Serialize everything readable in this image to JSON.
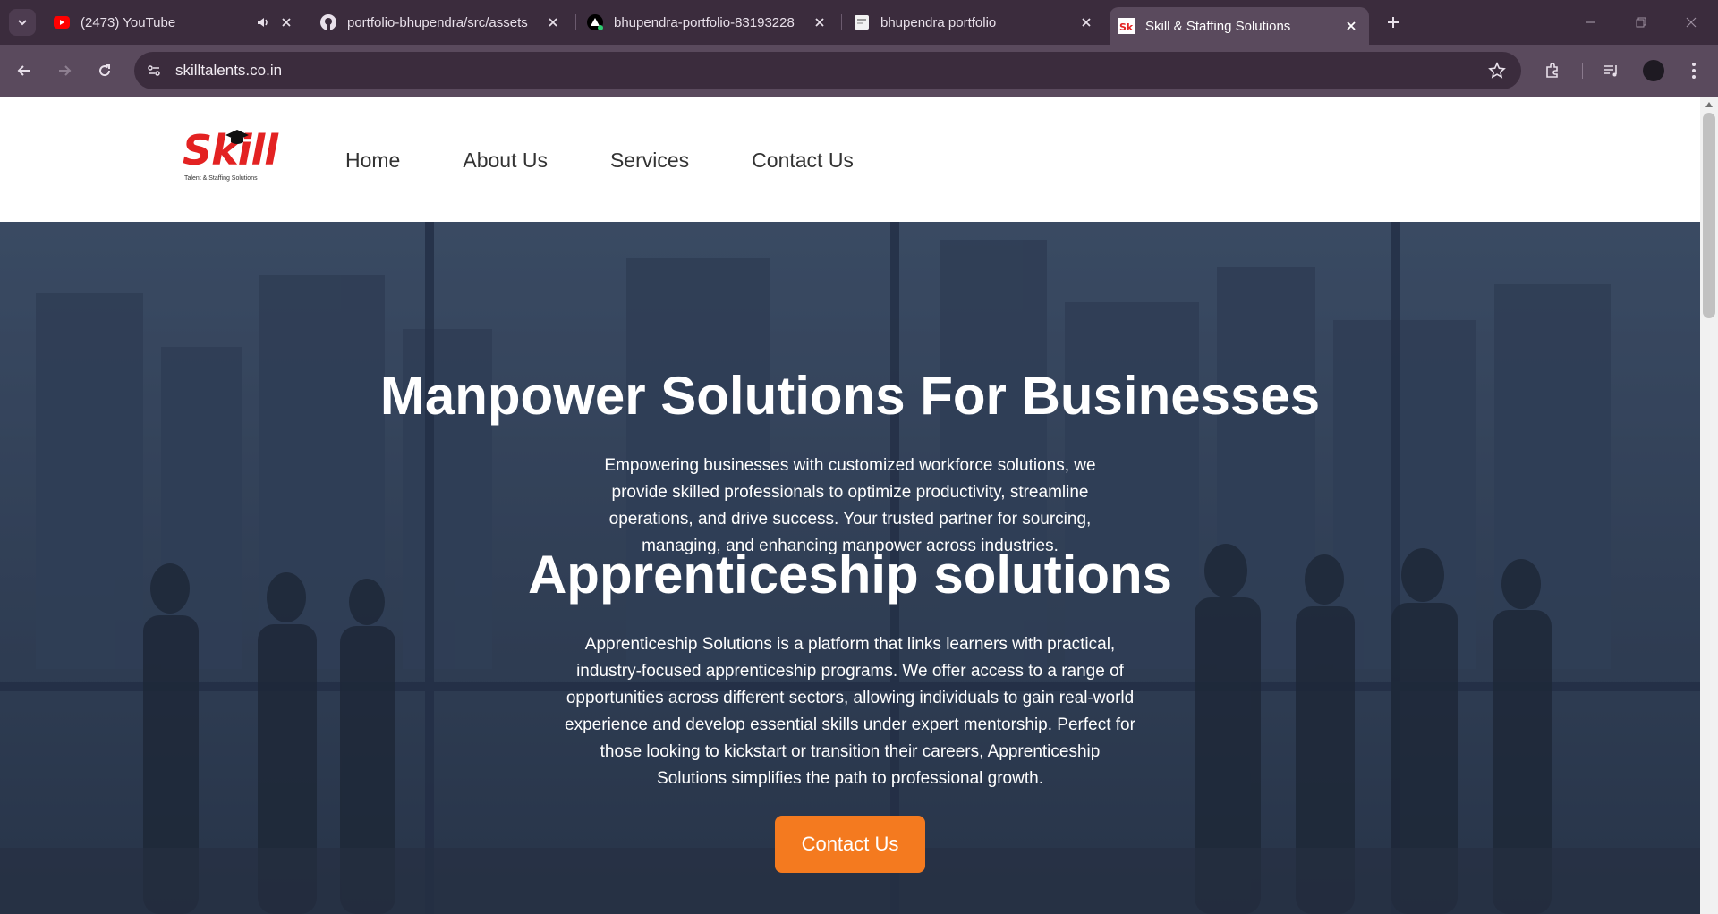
{
  "browser": {
    "tabs": [
      {
        "title": "(2473) YouTube",
        "favicon": "youtube-icon",
        "audio": true
      },
      {
        "title": "portfolio-bhupendra/src/assets",
        "favicon": "github-icon"
      },
      {
        "title": "bhupendra-portfolio-83193228",
        "favicon": "vercel-icon"
      },
      {
        "title": "bhupendra portfolio",
        "favicon": "page-icon"
      },
      {
        "title": "Skill & Staffing Solutions",
        "favicon": "skill-favicon",
        "active": true
      }
    ],
    "url": "skilltalents.co.in",
    "colors": {
      "frame": "#3b2c3d",
      "toolbar": "#5a4a5d"
    }
  },
  "site": {
    "logo": {
      "text": "Skill",
      "tagline": "Talent & Staffing Solutions"
    },
    "nav": [
      "Home",
      "About Us",
      "Services",
      "Contact Us"
    ],
    "hero": {
      "heading_1": "Manpower Solutions For Businesses",
      "text_1": "Empowering businesses with customized workforce solutions, we provide skilled professionals to optimize productivity, streamline operations, and drive success. Your trusted partner for sourcing, managing, and enhancing manpower across industries.",
      "heading_2": "Apprenticeship solutions",
      "text_2": "Apprenticeship Solutions is a platform that links learners with practical, industry-focused apprenticeship programs. We offer access to a range of opportunities across different sectors, allowing individuals to gain real-world experience and develop essential skills under expert mentorship. Perfect for those looking to kickstart or transition their careers, Apprenticeship Solutions simplifies the path to professional growth.",
      "cta_label": "Contact Us"
    },
    "colors": {
      "accent": "#f47a1f",
      "logo_red": "#e32222"
    }
  }
}
